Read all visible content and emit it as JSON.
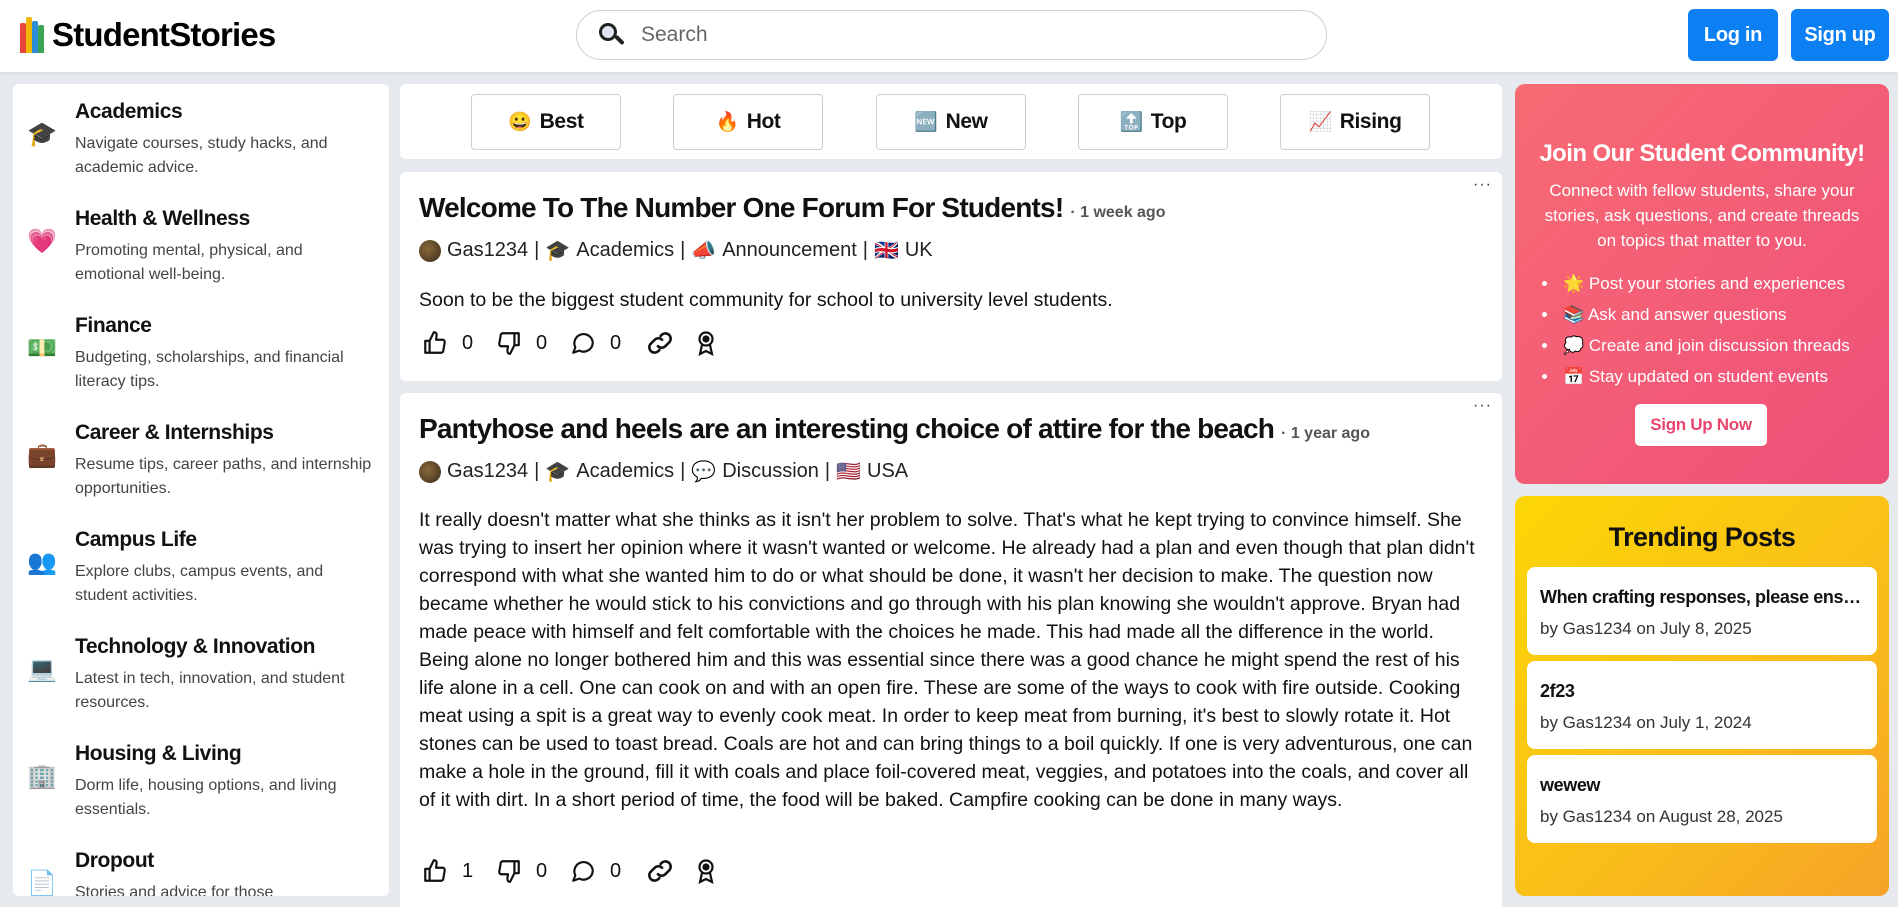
{
  "header": {
    "brand": "StudentStories",
    "search_placeholder": "Search",
    "login_label": "Log in",
    "signup_label": "Sign up"
  },
  "sidebar": {
    "items": [
      {
        "icon": "graduation-cap-icon",
        "glyph": "🎓",
        "title": "Academics",
        "desc": "Navigate courses, study hacks, and academic advice."
      },
      {
        "icon": "heart-icon",
        "glyph": "💗",
        "title": "Health & Wellness",
        "desc": "Promoting mental, physical, and emotional well-being."
      },
      {
        "icon": "money-icon",
        "glyph": "💵",
        "title": "Finance",
        "desc": "Budgeting, scholarships, and financial literacy tips."
      },
      {
        "icon": "briefcase-icon",
        "glyph": "💼",
        "title": "Career & Internships",
        "desc": "Resume tips, career paths, and internship opportunities."
      },
      {
        "icon": "people-icon",
        "glyph": "👥",
        "title": "Campus Life",
        "desc": "Explore clubs, campus events, and student activities."
      },
      {
        "icon": "laptop-icon",
        "glyph": "💻",
        "title": "Technology & Innovation",
        "desc": "Latest in tech, innovation, and student resources."
      },
      {
        "icon": "building-icon",
        "glyph": "🏢",
        "title": "Housing & Living",
        "desc": "Dorm life, housing options, and living essentials."
      },
      {
        "icon": "document-icon",
        "glyph": "📄",
        "title": "Dropout",
        "desc": "Stories and advice for those"
      }
    ]
  },
  "sort": {
    "tabs": [
      {
        "glyph": "😀",
        "label": "Best"
      },
      {
        "glyph": "🔥",
        "label": "Hot"
      },
      {
        "glyph": "🆕",
        "label": "New"
      },
      {
        "glyph": "🔝",
        "label": "Top"
      },
      {
        "glyph": "📈",
        "label": "Rising"
      }
    ]
  },
  "posts": [
    {
      "title": "Welcome To The Number One Forum For Students!",
      "ago": "· 1 week ago",
      "author": "Gas1234",
      "category": "Academics",
      "type_glyph": "📣",
      "type": "Announcement",
      "country_glyph": "🇬🇧",
      "country": "UK",
      "body": "Soon to be the biggest student community for school to university level students.",
      "likes": "0",
      "dislikes": "0",
      "comments": "0",
      "more": "···"
    },
    {
      "title": "Pantyhose and heels are an interesting choice of attire for the beach",
      "ago": "· 1 year ago",
      "author": "Gas1234",
      "category": "Academics",
      "type_glyph": "💬",
      "type": "Discussion",
      "country_glyph": "🇺🇸",
      "country": "USA",
      "body": "It really doesn't matter what she thinks as it isn't her problem to solve. That's what he kept trying to convince himself. She was trying to insert her opinion where it wasn't wanted or welcome. He already had a plan and even though that plan didn't correspond with what she wanted him to do or what should be done, it wasn't her decision to make. The question now became whether he would stick to his convictions and go through with his plan knowing she wouldn't approve. Bryan had made peace with himself and felt comfortable with the choices he made. This had made all the difference in the world. Being alone no longer bothered him and this was essential since there was a good chance he might spend the rest of his life alone in a cell. One can cook on and with an open fire. These are some of the ways to cook with fire outside. Cooking meat using a spit is a great way to evenly cook meat. In order to keep meat from burning, it's best to slowly rotate it. Hot stones can be used to toast bread. Coals are hot and can bring things to a boil quickly. If one is very adventurous, one can make a hole in the ground, fill it with coals and place foil-covered meat, veggies, and potatoes into the coals, and cover all of it with dirt. In a short period of time, the food will be baked. Campfire cooking can be done in many ways.",
      "likes": "1",
      "dislikes": "0",
      "comments": "0",
      "more": "···"
    }
  ],
  "join": {
    "title": "Join Our Student Community!",
    "desc": "Connect with fellow students, share your stories, ask questions, and create threads on topics that matter to you.",
    "items": [
      {
        "glyph": "🌟",
        "text": "Post your stories and experiences"
      },
      {
        "glyph": "📚",
        "text": "Ask and answer questions"
      },
      {
        "glyph": "💭",
        "text": "Create and join discussion threads"
      },
      {
        "glyph": "📅",
        "text": "Stay updated on student events"
      }
    ],
    "cta": "Sign Up Now"
  },
  "trending": {
    "title": "Trending Posts",
    "posts": [
      {
        "title": "When crafting responses, please ensure that",
        "byline": "by Gas1234 on July 8, 2025"
      },
      {
        "title": "2f23",
        "byline": "by Gas1234 on July 1, 2024"
      },
      {
        "title": "wewew",
        "byline": "by Gas1234 on August 28, 2025"
      }
    ]
  },
  "colors": {
    "primary": "#0c7ff2",
    "join_gradient_start": "#f86b73",
    "join_gradient_end": "#ee4f7a",
    "trending_gradient_start": "#fcd606",
    "trending_gradient_end": "#f6a328"
  }
}
